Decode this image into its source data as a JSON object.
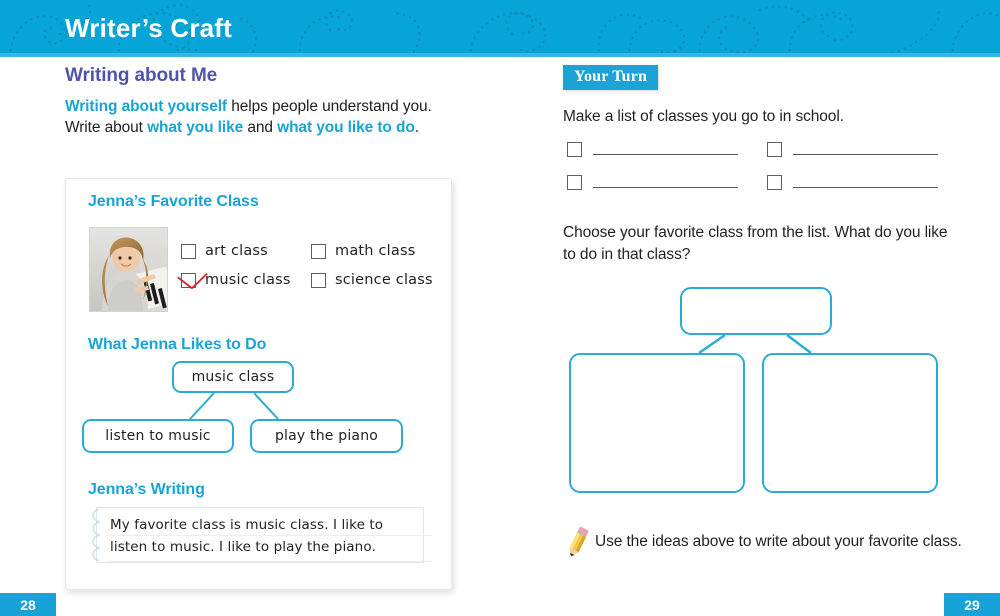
{
  "header": {
    "title": "Writer’s Craft",
    "bg_color": "#07a4d8",
    "swirl_color": "#1a7fb0"
  },
  "left": {
    "section_title": "Writing about Me",
    "intro": {
      "line1_hl": "Writing about yourself",
      "line1_rest": " helps people understand you.",
      "line2_pre": "Write about ",
      "line2_hl1": "what you like",
      "line2_mid": " and ",
      "line2_hl2": "what you like to do",
      "line2_end": "."
    },
    "example": {
      "favorite_heading": "Jenna’s Favorite Class",
      "photo_alt": "girl playing piano",
      "checkboxes": [
        {
          "label": "art class",
          "checked": false
        },
        {
          "label": "math class",
          "checked": false
        },
        {
          "label": "music class",
          "checked": true
        },
        {
          "label": "science class",
          "checked": false
        }
      ],
      "likes_heading": "What Jenna Likes to Do",
      "web": {
        "top": "music class",
        "left": "listen to music",
        "right": "play the piano"
      },
      "writing_heading": "Jenna’s Writing",
      "writing_text": "My favorite class is music class. I like to listen to music. I like to play the piano."
    }
  },
  "right": {
    "badge": "Your Turn",
    "prompt1": "Make a list of classes you go to in school.",
    "answer_lines": [
      "",
      "",
      "",
      ""
    ],
    "prompt2": "Choose your favorite class from the list. What do you like to do in that class?",
    "web_blank": {
      "top": "",
      "left": "",
      "right": ""
    },
    "footer_icon": "pencil-icon",
    "footer_text": "Use the ideas above to write about your favorite class."
  },
  "pages": {
    "left_page": "28",
    "right_page": "29"
  },
  "colors": {
    "header_blue": "#07a4d8",
    "heading_purple": "#4f55a8",
    "accent_cyan": "#18a5d6",
    "web_stroke": "#2cabd4",
    "check_red": "#d8232a",
    "text_dark": "#231f20"
  }
}
